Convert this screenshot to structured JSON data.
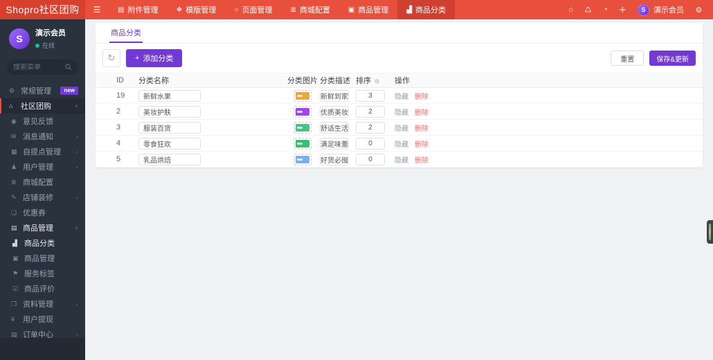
{
  "colors": {
    "header_red": "#e8503d",
    "header_red_dark": "#d8402e",
    "accent_purple": "#7239d4",
    "online_green": "#1abc9c",
    "delete_red": "#f16a6a",
    "sidebar_bg": "#2a323e"
  },
  "icons": {
    "hamburger": "☰",
    "attachment": "▤",
    "template": "❖",
    "page": "○",
    "mall_config": "≣",
    "goods": "▣",
    "category": "▟",
    "home": "⌂",
    "trash": "♺",
    "history": "◔",
    "fullscreen": "✛",
    "gear": "⚙",
    "cogs": "⚙",
    "feedback": "◉",
    "message": "✉",
    "bank": "▦",
    "user": "♟",
    "config": "≣",
    "brush": "✎",
    "coupon": "❏",
    "goods_manage": "▤",
    "category2": "▟",
    "goods2": "▣",
    "tag": "⚑",
    "review": "☑",
    "file": "❒",
    "yen": "¥",
    "order": "▤",
    "chevron_left": "‹",
    "chevron_down": "∨",
    "plus": "+",
    "refresh": "↻"
  },
  "header": {
    "logo": "Shopro社区团购",
    "tabs": [
      {
        "label": "附件管理",
        "active": false
      },
      {
        "label": "模版管理",
        "active": false
      },
      {
        "label": "页面管理",
        "active": false
      },
      {
        "label": "商城配置",
        "active": false
      },
      {
        "label": "商品管理",
        "active": false
      },
      {
        "label": "商品分类",
        "active": true
      }
    ],
    "user_name": "演示会员",
    "avatar_letter": "S"
  },
  "sidebar": {
    "user_name": "演示会员",
    "avatar_letter": "S",
    "status": "在线",
    "search_placeholder": "搜索菜单",
    "badge_new": "new",
    "items": [
      {
        "label": "常规管理"
      },
      {
        "label": "社区团购"
      },
      {
        "label": "意见反馈"
      },
      {
        "label": "消息通知"
      },
      {
        "label": "自提点管理"
      },
      {
        "label": "用户管理"
      },
      {
        "label": "商城配置"
      },
      {
        "label": "店铺装修"
      },
      {
        "label": "优惠券"
      },
      {
        "label": "商品管理"
      },
      {
        "label": "商品分类"
      },
      {
        "label": "商品管理"
      },
      {
        "label": "服务标签"
      },
      {
        "label": "商品评价"
      },
      {
        "label": "资料管理"
      },
      {
        "label": "用户提现"
      },
      {
        "label": "订单中心"
      }
    ]
  },
  "main": {
    "tab_title": "商品分类",
    "toolbar": {
      "add": "添加分类",
      "reset": "重置",
      "save": "保存&更新"
    },
    "table": {
      "headers": [
        "ID",
        "分类名称",
        "分类图片",
        "分类描述",
        "排序",
        "操作"
      ],
      "hide": "隐藏",
      "delete": "删除",
      "rows": [
        {
          "id": "19",
          "name": "新鲜水果",
          "img": "#f0a43c",
          "desc": "新鲜到家",
          "sort": "3"
        },
        {
          "id": "2",
          "name": "美妆护肤",
          "img": "#a044ee",
          "desc": "优质美妆",
          "sort": "2"
        },
        {
          "id": "3",
          "name": "服装百货",
          "img": "#4cc08a",
          "desc": "舒适生活",
          "sort": "2"
        },
        {
          "id": "4",
          "name": "零食狂欢",
          "img": "#3bbd72",
          "desc": "满足味蕾",
          "sort": "0"
        },
        {
          "id": "5",
          "name": "乳品烘焙",
          "img": "#78aef2",
          "desc": "好货必囤",
          "sort": "0"
        }
      ]
    }
  }
}
